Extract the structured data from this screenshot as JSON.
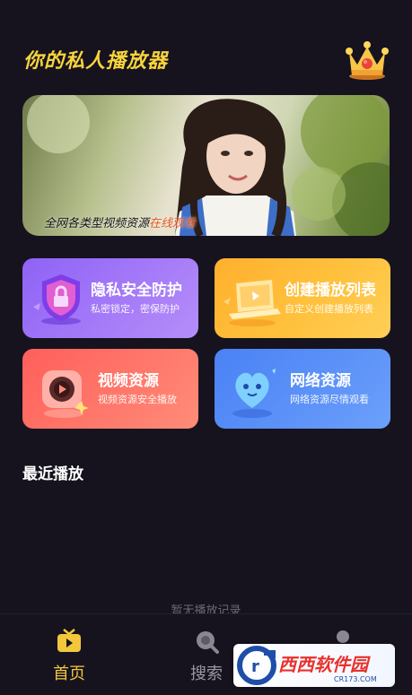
{
  "header": {
    "title": "你的私人播放器",
    "vip_icon": "crown-icon"
  },
  "banner": {
    "caption_prefix": "全网各类型视频资源",
    "caption_highlight": "在线观看"
  },
  "features": [
    {
      "title": "隐私安全防护",
      "subtitle": "私密锁定，密保防护",
      "icon": "shield-lock-icon"
    },
    {
      "title": "创建播放列表",
      "subtitle": "自定义创建播放列表",
      "icon": "laptop-playlist-icon"
    },
    {
      "title": "视频资源",
      "subtitle": "视频资源安全播放",
      "icon": "camera-play-icon"
    },
    {
      "title": "网络资源",
      "subtitle": "网络资源尽情观看",
      "icon": "heart-face-icon"
    }
  ],
  "recent": {
    "title": "最近播放",
    "empty_text": "暂无播放记录"
  },
  "tabbar": {
    "items": [
      {
        "label": "首页",
        "icon": "tv-icon",
        "active": true
      },
      {
        "label": "搜索",
        "icon": "search-icon",
        "active": false
      },
      {
        "label": "",
        "icon": "user-icon",
        "active": false
      }
    ]
  },
  "watermark": {
    "text": "西西软件园",
    "sub": "CR173.COM"
  },
  "colors": {
    "background": "#16131f",
    "accent": "#f2c73b",
    "title": "#f7d43c",
    "highlight": "#e8541d"
  }
}
